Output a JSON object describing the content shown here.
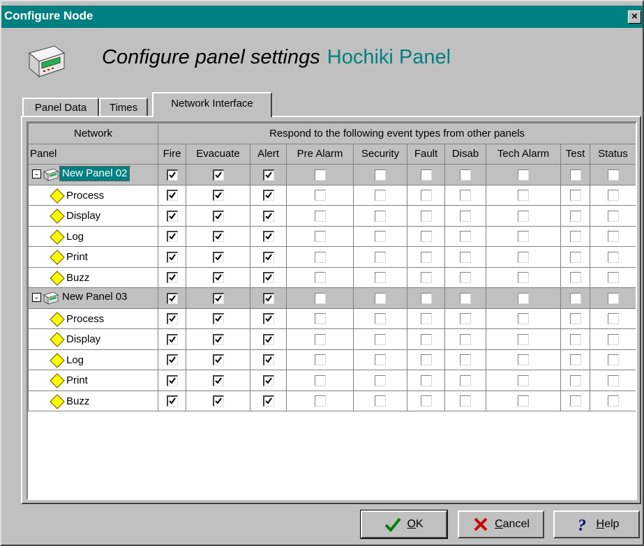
{
  "window": {
    "title": "Configure Node",
    "close_glyph": "×"
  },
  "header": {
    "main": "Configure panel settings",
    "panel_name": "Hochiki Panel",
    "icon": "panel-device-icon"
  },
  "tabs": [
    {
      "label": "Panel Data"
    },
    {
      "label": "Times"
    },
    {
      "label": "Network Interface",
      "active": true
    }
  ],
  "grid": {
    "group_header_network": "Network",
    "group_header_events": "Respond to the following event types from other panels",
    "col_panel": "Panel",
    "columns": [
      "Fire",
      "Evacuate",
      "Alert",
      "Pre Alarm",
      "Security",
      "Fault",
      "Disab",
      "Tech Alarm",
      "Test",
      "Status"
    ],
    "panels": [
      {
        "name": "New Panel 02",
        "expander": "-",
        "selected": true,
        "checks": [
          1,
          1,
          1,
          0,
          0,
          0,
          0,
          0,
          0,
          0
        ],
        "children": [
          {
            "label": "Process",
            "checks": [
              1,
              1,
              1,
              0,
              0,
              0,
              0,
              0,
              0,
              0
            ]
          },
          {
            "label": "Display",
            "checks": [
              1,
              1,
              1,
              0,
              0,
              0,
              0,
              0,
              0,
              0
            ]
          },
          {
            "label": "Log",
            "checks": [
              1,
              1,
              1,
              0,
              0,
              0,
              0,
              0,
              0,
              0
            ]
          },
          {
            "label": "Print",
            "checks": [
              1,
              1,
              1,
              0,
              0,
              0,
              0,
              0,
              0,
              0
            ]
          },
          {
            "label": "Buzz",
            "checks": [
              1,
              1,
              1,
              0,
              0,
              0,
              0,
              0,
              0,
              0
            ]
          }
        ]
      },
      {
        "name": "New Panel 03",
        "expander": "-",
        "selected": false,
        "checks": [
          1,
          1,
          1,
          0,
          0,
          0,
          0,
          0,
          0,
          0
        ],
        "children": [
          {
            "label": "Process",
            "checks": [
              1,
              1,
              1,
              0,
              0,
              0,
              0,
              0,
              0,
              0
            ]
          },
          {
            "label": "Display",
            "checks": [
              1,
              1,
              1,
              0,
              0,
              0,
              0,
              0,
              0,
              0
            ]
          },
          {
            "label": "Log",
            "checks": [
              1,
              1,
              1,
              0,
              0,
              0,
              0,
              0,
              0,
              0
            ]
          },
          {
            "label": "Print",
            "checks": [
              1,
              1,
              1,
              0,
              0,
              0,
              0,
              0,
              0,
              0
            ]
          },
          {
            "label": "Buzz",
            "checks": [
              1,
              1,
              1,
              0,
              0,
              0,
              0,
              0,
              0,
              0
            ]
          }
        ]
      }
    ]
  },
  "buttons": {
    "ok": {
      "label": "OK",
      "mnemonic": "O",
      "rest": "K"
    },
    "cancel": {
      "label": "Cancel",
      "mnemonic": "C",
      "rest": "ancel"
    },
    "help": {
      "label": "Help",
      "mnemonic": "H",
      "rest": "elp"
    }
  },
  "colors": {
    "title_bar": "#008080",
    "accent_text": "#008080",
    "face": "#c0c0c0",
    "selection": "#008080"
  }
}
